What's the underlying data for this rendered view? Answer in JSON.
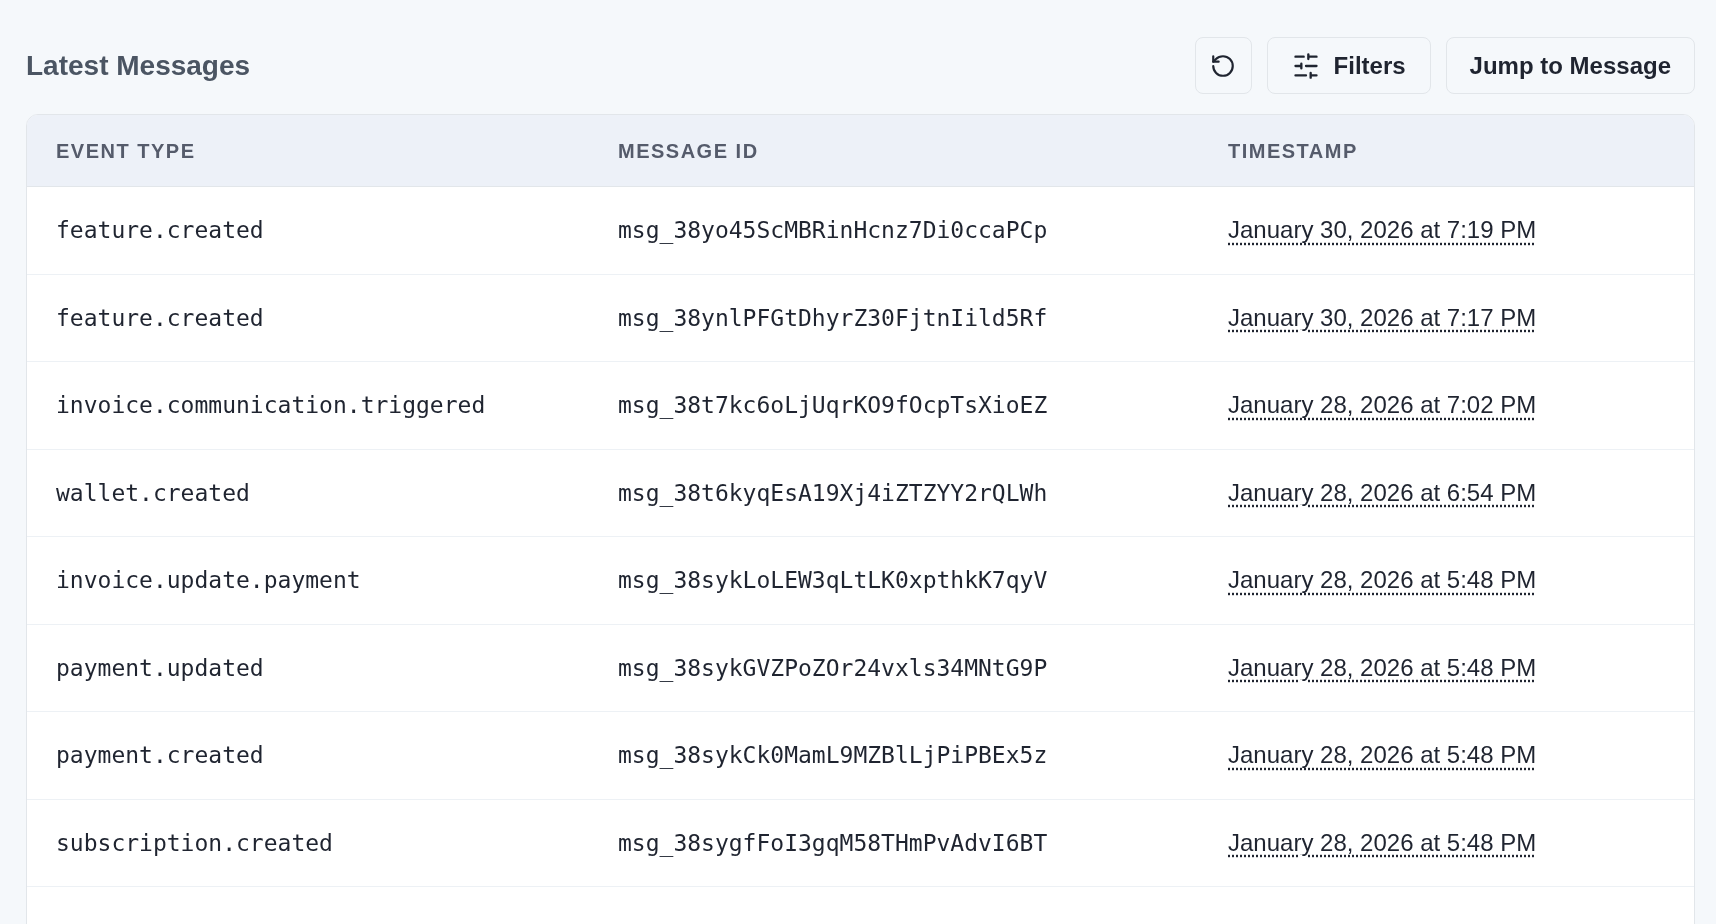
{
  "title": "Latest Messages",
  "toolbar": {
    "filters_label": "Filters",
    "jump_label": "Jump to Message"
  },
  "table": {
    "columns": [
      "EVENT TYPE",
      "MESSAGE ID",
      "TIMESTAMP"
    ],
    "rows": [
      {
        "event_type": "feature.created",
        "message_id": "msg_38yo45ScMBRinHcnz7Di0ccaPCp",
        "timestamp": "January 30, 2026 at 7:19 PM"
      },
      {
        "event_type": "feature.created",
        "message_id": "msg_38ynlPFGtDhyrZ30FjtnIild5Rf",
        "timestamp": "January 30, 2026 at 7:17 PM"
      },
      {
        "event_type": "invoice.communication.triggered",
        "message_id": "msg_38t7kc6oLjUqrKO9fOcpTsXioEZ",
        "timestamp": "January 28, 2026 at 7:02 PM"
      },
      {
        "event_type": "wallet.created",
        "message_id": "msg_38t6kyqEsA19Xj4iZTZYY2rQLWh",
        "timestamp": "January 28, 2026 at 6:54 PM"
      },
      {
        "event_type": "invoice.update.payment",
        "message_id": "msg_38sykLoLEW3qLtLK0xpthkK7qyV",
        "timestamp": "January 28, 2026 at 5:48 PM"
      },
      {
        "event_type": "payment.updated",
        "message_id": "msg_38sykGVZPoZOr24vxls34MNtG9P",
        "timestamp": "January 28, 2026 at 5:48 PM"
      },
      {
        "event_type": "payment.created",
        "message_id": "msg_38sykCk0MamL9MZBlLjPiPBEx5z",
        "timestamp": "January 28, 2026 at 5:48 PM"
      },
      {
        "event_type": "subscription.created",
        "message_id": "msg_38sygfFoI3gqM58THmPvAdvI6BT",
        "timestamp": "January 28, 2026 at 5:48 PM"
      }
    ]
  }
}
